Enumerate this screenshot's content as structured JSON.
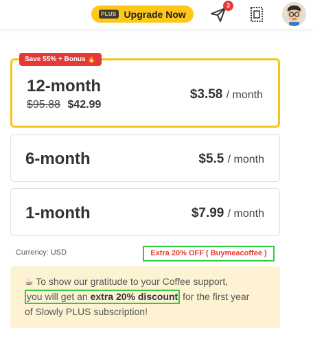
{
  "header": {
    "upgrade_badge": "PLUS",
    "upgrade_label": "Upgrade Now",
    "notification_count": "3",
    "icons": [
      "send-icon",
      "stamp-icon",
      "avatar"
    ]
  },
  "plans": {
    "twelve": {
      "badge": "Save 55% + Bonus 🔥",
      "name": "12-month",
      "old_price": "$95.88",
      "new_price": "$42.99",
      "monthly": "$3.58",
      "per": "/ month"
    },
    "six": {
      "name": "6-month",
      "monthly": "$5.5",
      "per": "/ month"
    },
    "one": {
      "name": "1-month",
      "monthly": "$7.99",
      "per": "/ month"
    }
  },
  "currency": "Currency: USD",
  "promo": "Extra 20% OFF ( Buymeacoffee )",
  "notice": {
    "line1": "To show our gratitude to your Coffee support,",
    "line2_pre": "you will get an ",
    "line2_bold": "extra 20% discount",
    "line2_post": " for the first year",
    "line3": "of Slowly PLUS subscription!"
  },
  "colors": {
    "accent": "#ffc71a",
    "selected_border": "#f5c518",
    "badge_red": "#e53935",
    "highlight_green": "#2ecc40",
    "notice_bg": "#fdf3d3"
  }
}
